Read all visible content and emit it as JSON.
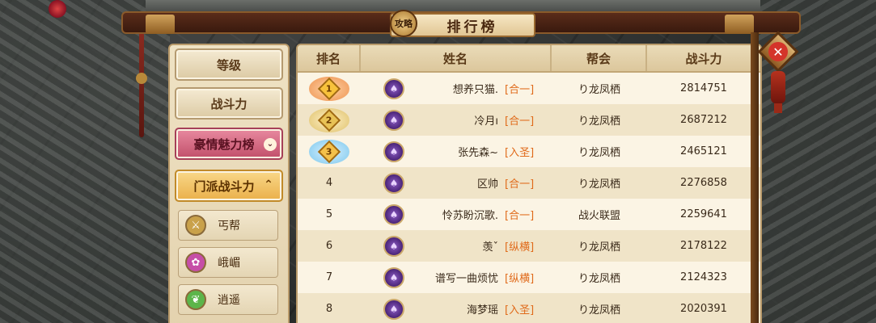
{
  "title": "排行榜",
  "title_badge": "攻略",
  "sidebar": {
    "buttons": [
      {
        "label": "等级"
      },
      {
        "label": "战斗力"
      },
      {
        "label": "豪情魅力榜",
        "chevron": "⌄"
      },
      {
        "label": "门派战斗力",
        "chevron": "⌃"
      }
    ],
    "sects": [
      {
        "label": "丐帮",
        "icon": "sword-icon",
        "color": "#c9a14a"
      },
      {
        "label": "峨嵋",
        "icon": "lotus-icon",
        "color": "#c64fa7"
      },
      {
        "label": "逍遥",
        "icon": "leaf-icon",
        "color": "#5cb54a"
      }
    ]
  },
  "table": {
    "headers": [
      "排名",
      "姓名",
      "帮会",
      "战斗力"
    ],
    "rows": [
      {
        "rank": "1",
        "name": "想养只猫.",
        "server": "[合一]",
        "guild": "り龙凤栖",
        "power": "2814751"
      },
      {
        "rank": "2",
        "name": "冷月ı",
        "server": "[合一]",
        "guild": "り龙凤栖",
        "power": "2687212"
      },
      {
        "rank": "3",
        "name": "张先森~",
        "server": "[入圣]",
        "guild": "り龙凤栖",
        "power": "2465121"
      },
      {
        "rank": "4",
        "name": "区帅",
        "server": "[合一]",
        "guild": "り龙凤栖",
        "power": "2276858"
      },
      {
        "rank": "5",
        "name": "怜苏盼沉歌.",
        "server": "[合一]",
        "guild": "战火联盟",
        "power": "2259641"
      },
      {
        "rank": "6",
        "name": "羡ˇ",
        "server": "[纵横]",
        "guild": "り龙凤栖",
        "power": "2178122"
      },
      {
        "rank": "7",
        "name": "谱写一曲烦忧",
        "server": "[纵横]",
        "guild": "り龙凤栖",
        "power": "2124323"
      },
      {
        "rank": "8",
        "name": "海梦瑶",
        "server": "[入圣]",
        "guild": "り龙凤栖",
        "power": "2020391"
      }
    ]
  },
  "close_label": "✕"
}
